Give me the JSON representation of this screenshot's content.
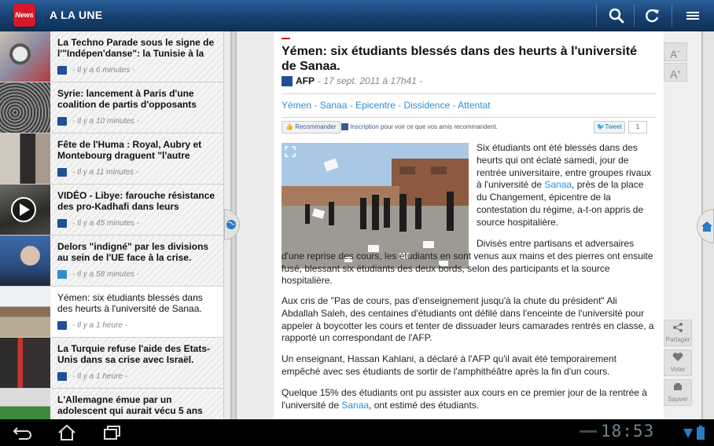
{
  "app": {
    "logo_text": "News",
    "title": "A LA UNE"
  },
  "toolbar": {
    "icons": [
      "search-icon",
      "refresh-icon",
      "menu-icon"
    ]
  },
  "list": [
    {
      "title": "La Techno Parade sous le signe de l'\"Indépen'danse\": la Tunisie à la fête.",
      "time": "- Il y a 6 minutes -",
      "source_icon": "afp-logo"
    },
    {
      "title": "Syrie: lancement à Paris d'une coalition de partis d'opposants",
      "time": "- Il y a 10 minutes -",
      "source_icon": "afp-logo"
    },
    {
      "title": "Fête de l'Huma : Royal, Aubry et Montebourg draguent \"l'autre",
      "time": "- Il y a 11 minutes -",
      "source_icon": "afp-logo"
    },
    {
      "title": "VIDÉO - Libye: farouche résistance des pro-Kadhafi dans leurs derniers",
      "time": "- Il y a 45 minutes -",
      "source_icon": "afp-logo"
    },
    {
      "title": "Delors \"indigné\" par les divisions au sein de l'UE face à la crise.",
      "time": "- Il y a 58 minutes -",
      "source_icon": "p-logo"
    },
    {
      "title": "Yémen: six étudiants blessés dans des heurts à l'université de Sanaa.",
      "time": "- Il y a 1 heure -",
      "source_icon": "afp-logo"
    },
    {
      "title": "La Turquie refuse l'aide des Etats-Unis dans sa crise avec Israël.",
      "time": "- Il y a 1 heure -",
      "source_icon": "afp-logo"
    },
    {
      "title": "L'Allemagne émue par un adolescent qui aurait vécu 5 ans",
      "time": "",
      "source_icon": ""
    }
  ],
  "article": {
    "title": "Yémen: six étudiants blessés dans des heurts à l'université de Sanaa.",
    "source": "AFP",
    "date": "- 17 sept. 2011 à 17h41 -",
    "tags": [
      "Yémen",
      "Sanaa",
      "Epicentre",
      "Dissidence",
      "Attentat"
    ],
    "tag_sep": " - ",
    "social": {
      "recommend": "Recommander",
      "inscription": "Inscription",
      "inscription_text": "pour voir ce que vos amis recommandent.",
      "tweet": "Tweet",
      "tweet_count": "1"
    },
    "p1_a": "Six étudiants ont été blessés dans des heurts qui ont éclaté samedi, jour de rentrée universitaire, entre groupes rivaux à l'université de ",
    "p1_link": "Sanaa",
    "p1_b": ", près de la place du Changement, épicentre de la contestation du régime, a-t-on appris de source hospitalière.",
    "p2": "Divisés entre partisans et adversaires d'une reprise des cours, les étudiants en sont venus aux mains et des pierres ont ensuite fusé, blessant six étudiants des deux bords, selon des participants et la source hospitalière.",
    "p3": "Aux cris de \"Pas de cours, pas d'enseignement jusqu'à la chute du président\" Ali Abdallah Saleh, des centaines d'étudiants ont défilé dans l'enceinte de l'université pour appeler à boycotter les cours et tenter de dissuader leurs camarades rentrés en classe, a rapporté un correspondant de l'AFP.",
    "p4": "Un enseignant, Hassan Kahlani, a déclaré à l'AFP qu'il avait été temporairement empêché avec ses étudiants de sortir de l'amphithéâtre après la fin d'un cours.",
    "p5_a": "Quelque 15% des étudiants ont pu assister aux cours en ce premier jour de la rentrée à l'université de ",
    "p5_link": "Sanaa",
    "p5_b": ", ont estimé des étudiants."
  },
  "right": {
    "font_smaller": "A",
    "font_larger": "A",
    "share": "Partager",
    "vote": "Voter",
    "save": "Sauver"
  },
  "system": {
    "clock": "18:53"
  },
  "colors": {
    "accent": "#d6182a",
    "link": "#2a8fd4",
    "topbar": "#16406f"
  }
}
